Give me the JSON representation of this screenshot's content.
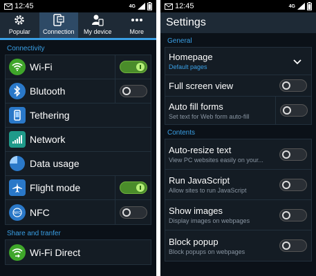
{
  "left": {
    "status": {
      "time": "12:45",
      "network": "4G"
    },
    "tabs": [
      {
        "label": "Popular",
        "icon": "gear-icon",
        "active": false
      },
      {
        "label": "Connection",
        "icon": "phone-connection-icon",
        "active": true
      },
      {
        "label": "My device",
        "icon": "person-device-icon",
        "active": false
      },
      {
        "label": "More",
        "icon": "more-dots-icon",
        "active": false
      }
    ],
    "section_connectivity": "Connectivity",
    "items": [
      {
        "label": "Wi-Fi",
        "icon": "wifi-icon",
        "icon_color": "#3fa62a",
        "toggle": "on"
      },
      {
        "label": "Blutooth",
        "icon": "bluetooth-icon",
        "icon_color": "#2a78c8",
        "toggle": "off"
      },
      {
        "label": "Tethering",
        "icon": "tethering-icon",
        "icon_color": "#2a78c8",
        "toggle": null
      },
      {
        "label": "Network",
        "icon": "signal-icon",
        "icon_color": "#1f9a8a",
        "toggle": null
      },
      {
        "label": "Data usage",
        "icon": "pie-chart-icon",
        "icon_color": "#2a78c8",
        "toggle": null
      },
      {
        "label": "Flight mode",
        "icon": "airplane-icon",
        "icon_color": "#2a78c8",
        "toggle": "on"
      },
      {
        "label": "NFC",
        "icon": "nfc-icon",
        "icon_color": "#2a78c8",
        "toggle": "off"
      }
    ],
    "section_share": "Share and tranfer",
    "share_items": [
      {
        "label": "Wi-Fi Direct",
        "icon": "wifi-direct-icon",
        "icon_color": "#3fa62a"
      }
    ]
  },
  "right": {
    "status": {
      "time": "12:45",
      "network": "4G"
    },
    "title": "Settings",
    "section_general": "General",
    "general": [
      {
        "title": "Homepage",
        "subtitle": "Default pages",
        "control": "dropdown"
      },
      {
        "title": "Full screen view",
        "subtitle": "",
        "control": "toggle-off"
      },
      {
        "title": "Auto fill forms",
        "subtitle": "Set text for Web form auto-fill",
        "control": "toggle-off"
      }
    ],
    "section_contents": "Contents",
    "contents": [
      {
        "title": "Auto-resize text",
        "subtitle": "View PC websites easily on your...",
        "control": "toggle-off"
      },
      {
        "title": "Run JavaScript",
        "subtitle": "Allow sites to run JavaScript",
        "control": "toggle-off"
      },
      {
        "title": "Show images",
        "subtitle": "Display images on webpages",
        "control": "toggle-off"
      },
      {
        "title": "Block popup",
        "subtitle": "Block popups on webpages",
        "control": "toggle-off"
      }
    ]
  },
  "colors": {
    "accent": "#3aa0e6",
    "background": "#0b1118",
    "toggle_on": "#4a8c2a"
  }
}
